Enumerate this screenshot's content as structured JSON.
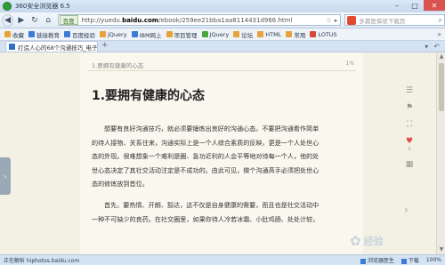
{
  "window": {
    "title": "360安全浏览器 6.5",
    "controls": [
      "minimize-icon",
      "maximize-icon",
      "close-icon"
    ]
  },
  "navbar": {
    "engine_label": "百度",
    "url_plain": "http://yuedu.",
    "url_bold": "baidu.com",
    "url_rest": "/ebook/259ee21bba1aa8114431d966.html",
    "search_placeholder": "多篇医保状下载页",
    "colors": {
      "engine_green": "#2e6a1f",
      "search_red": "#e34a2f"
    }
  },
  "bookmarks": {
    "items": [
      {
        "label": "收藏",
        "icon": "star-icon"
      },
      {
        "label": "链接教育",
        "icon": "link-icon"
      },
      {
        "label": "百度经验",
        "icon": "paw-icon"
      },
      {
        "label": "jQuery",
        "icon": "folder-icon"
      },
      {
        "label": "IBM网上",
        "icon": "folder-icon"
      },
      {
        "label": "项目管理",
        "icon": "folder-icon"
      },
      {
        "label": "JQuery",
        "icon": "folder-icon"
      },
      {
        "label": "论坛",
        "icon": "folder-icon"
      },
      {
        "label": "HTML",
        "icon": "folder-icon"
      },
      {
        "label": "常用",
        "icon": "folder-icon"
      },
      {
        "label": "LOTUS",
        "icon": "folder-icon"
      }
    ]
  },
  "tabs": [
    {
      "label": "打造人心的68个沟通技巧_电子书免费",
      "active": true
    }
  ],
  "document": {
    "breadcrumb": "1.要拥有健康的心态",
    "percent": "1%",
    "heading": "1.要拥有健康的心态",
    "paragraph1": [
      "想要有良好沟通技巧，就必须要锤炼出良好的沟通心态。不要把沟通看作简单",
      "的待人接物、关系往来，沟通实际上是一个人综合素质的反映，更是一个人处世心",
      "态的外现。很难想象一个难利是圈、急功近利的人会平等地对待每一个人，他的处",
      "世心态决定了其社交活动注定是不成功的。由此可见，做个沟通高手必须把处世心",
      "态的修炼放到首位。"
    ],
    "paragraph2": [
      "首先，要热情、开朗、豁达，这不仅是自身健康的需要，而且也是社交活动中",
      "一种不可缺少的良药。在社交圈里，如果你待人冷若冰霜、小肚鸡肠、处处计较，"
    ]
  },
  "sidetools": {
    "items": [
      "list-icon",
      "bookmark-icon",
      "fullscreen-icon",
      "heart-icon",
      "grid-icon"
    ],
    "heart_count": "1",
    "accent": "#e04b4b"
  },
  "watermark": {
    "text": "经验",
    "icon": "paw-icon"
  },
  "statusbar": {
    "left": "正在解析 hiphotos.baidu.com",
    "right": [
      "浏览器医生",
      "下载",
      "100%"
    ]
  }
}
